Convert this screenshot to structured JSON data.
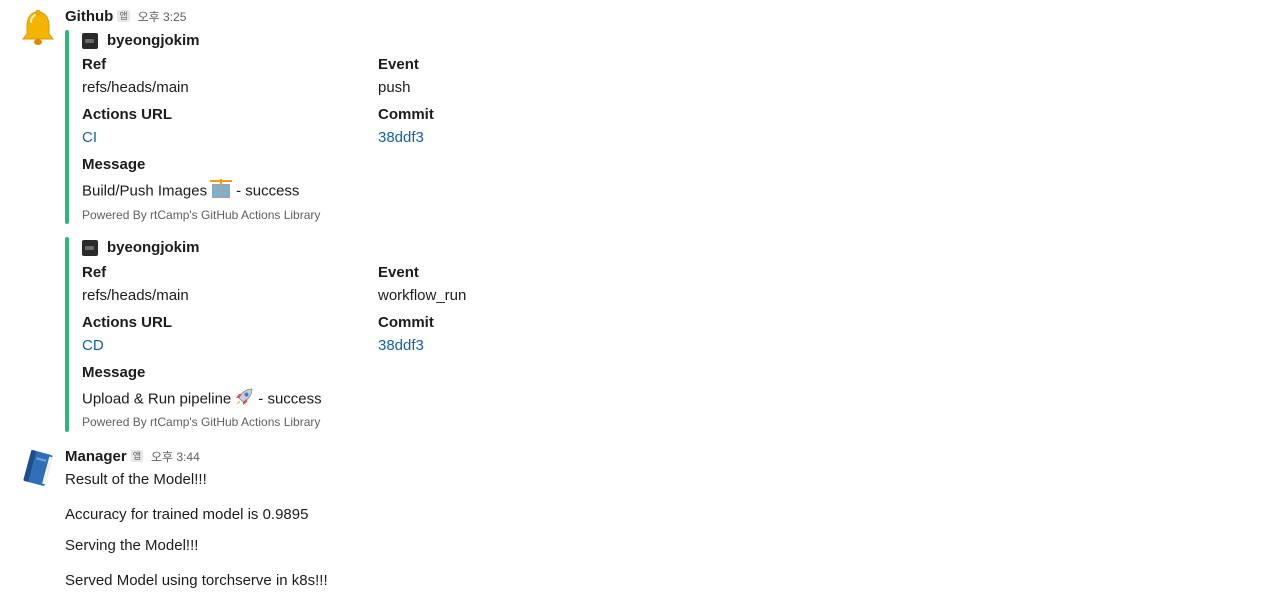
{
  "messages": [
    {
      "sender": "Github",
      "app_badge": "앱",
      "time": "오후 3:25",
      "avatar_icon": "bell-icon",
      "attachments": [
        {
          "author": "byeongjokim",
          "fields": {
            "ref_title": "Ref",
            "ref_value": "refs/heads/main",
            "event_title": "Event",
            "event_value": "push",
            "actions_title": "Actions URL",
            "actions_value": "CI",
            "commit_title": "Commit",
            "commit_value": "38ddf3",
            "message_title": "Message",
            "message_before": "Build/Push Images",
            "message_emoji": "building-construction-icon",
            "message_after": "- success"
          },
          "footer": "Powered By rtCamp's GitHub Actions Library"
        },
        {
          "author": "byeongjokim",
          "fields": {
            "ref_title": "Ref",
            "ref_value": "refs/heads/main",
            "event_title": "Event",
            "event_value": "workflow_run",
            "actions_title": "Actions URL",
            "actions_value": "CD",
            "commit_title": "Commit",
            "commit_value": "38ddf3",
            "message_title": "Message",
            "message_before": "Upload & Run pipeline",
            "message_emoji": "rocket-icon",
            "message_after": "- success"
          },
          "footer": "Powered By rtCamp's GitHub Actions Library"
        }
      ]
    },
    {
      "sender": "Manager",
      "app_badge": "앱",
      "time": "오후 3:44",
      "avatar_icon": "blue-book-icon",
      "lines": [
        "Result of the Model!!!",
        "Accuracy for trained model is 0.9895",
        "Serving the Model!!!",
        "Served Model using torchserve in k8s!!!"
      ]
    }
  ],
  "colors": {
    "attachment_bar": "#2eb67d",
    "link": "#1264a3",
    "muted_text": "#616061",
    "text": "#1d1c1d"
  }
}
